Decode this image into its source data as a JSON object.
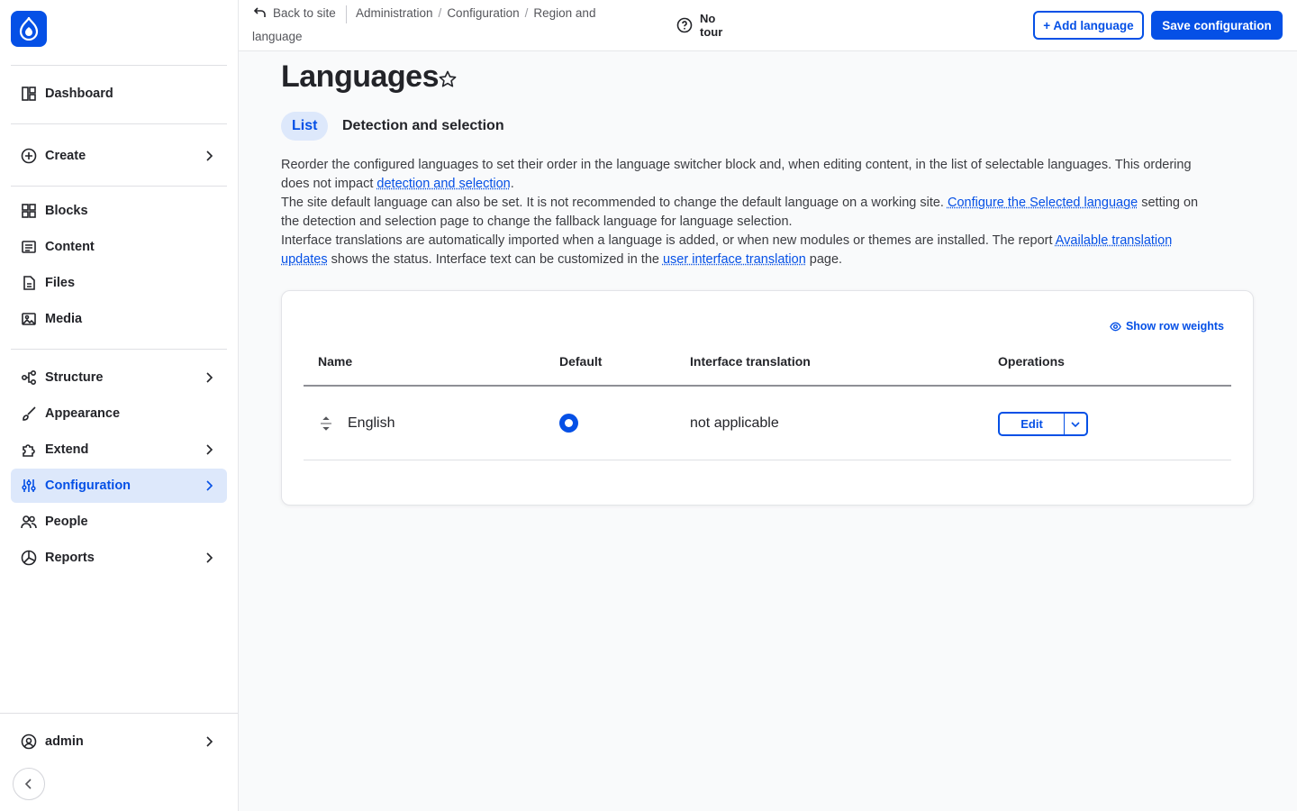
{
  "sidebar": {
    "items": [
      {
        "label": "Dashboard",
        "icon": "dashboard-icon"
      },
      {
        "label": "Create",
        "icon": "plus-circle-icon"
      },
      {
        "label": "Blocks",
        "icon": "blocks-icon"
      },
      {
        "label": "Content",
        "icon": "content-icon"
      },
      {
        "label": "Files",
        "icon": "file-icon"
      },
      {
        "label": "Media",
        "icon": "media-icon"
      },
      {
        "label": "Structure",
        "icon": "structure-icon"
      },
      {
        "label": "Appearance",
        "icon": "brush-icon"
      },
      {
        "label": "Extend",
        "icon": "puzzle-icon"
      },
      {
        "label": "Configuration",
        "icon": "sliders-icon"
      },
      {
        "label": "People",
        "icon": "people-icon"
      },
      {
        "label": "Reports",
        "icon": "pie-chart-icon"
      }
    ],
    "user": {
      "label": "admin",
      "icon": "user-circle-icon"
    },
    "active_item": "Configuration"
  },
  "topbar": {
    "back_label": "Back to site",
    "breadcrumb": [
      "Administration",
      "Configuration",
      "Region and"
    ],
    "breadcrumb_wrap": "language",
    "tour_line1": "No",
    "tour_line2": "tour",
    "add_language": "+ Add language",
    "save_configuration": "Save configuration"
  },
  "page": {
    "title": "Languages",
    "tabs": [
      {
        "label": "List",
        "active": true
      },
      {
        "label": "Detection and selection",
        "active": false
      }
    ]
  },
  "description": {
    "p1_a": "Reorder the configured languages to set their order in the language switcher block and, when editing content, in the list of selectable languages. This or­dering does not impact ",
    "p1_link": "detection and selection",
    "p1_b": ".",
    "p2_a": "The site default language can also be set. It is not recommended to change the default language on a working site. ",
    "p2_link": "Configure the Selected language",
    "p2_b": " set­ting on the detection and selection page to change the fallback language for language selection.",
    "p3_a": "Interface translations are automatically imported when a language is added, or when new modules or themes are installed. The report ",
    "p3_link1": "Available translation updates",
    "p3_b": " shows the status. Interface text can be customized in the ",
    "p3_link2": "user interface translation",
    "p3_c": " page."
  },
  "table": {
    "show_row_weights": "Show row weights",
    "columns": [
      "Name",
      "Default",
      "Interface translation",
      "Operations"
    ],
    "rows": [
      {
        "name": "English",
        "default": true,
        "interface_translation": "not applicable",
        "operation": "Edit"
      }
    ]
  },
  "colors": {
    "accent": "#0550e6",
    "active_bg": "#dde8fb"
  }
}
